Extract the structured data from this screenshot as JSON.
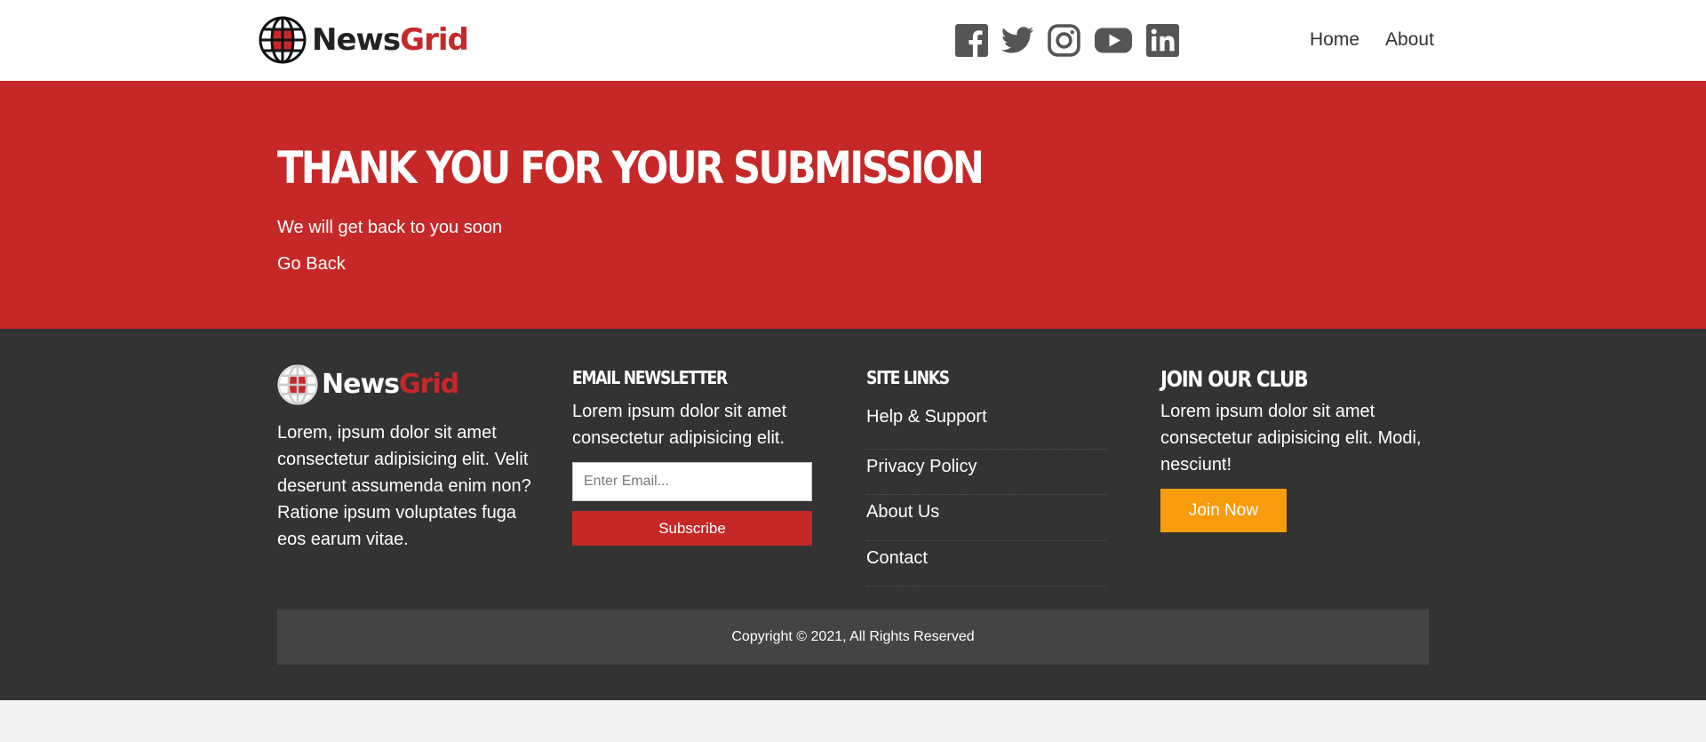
{
  "brand": {
    "name_part1": "News",
    "name_part2": "Grid",
    "accent": "#c62828",
    "logo_icon": "globe-icon"
  },
  "header": {
    "social": [
      {
        "name": "facebook-icon"
      },
      {
        "name": "twitter-icon"
      },
      {
        "name": "instagram-icon"
      },
      {
        "name": "youtube-icon"
      },
      {
        "name": "linkedin-icon"
      }
    ],
    "nav": {
      "home": "Home",
      "about": "About"
    }
  },
  "hero": {
    "title": "Thank You For Your Submission",
    "subtitle": "We will get back to you soon",
    "back_link": "Go Back",
    "background": "#c62828"
  },
  "footer": {
    "about_text": "Lorem, ipsum dolor sit amet consectetur adipisicing elit. Velit deserunt assumenda enim non? Ratione ipsum voluptates fuga eos earum vitae.",
    "newsletter": {
      "heading": "Email Newsletter",
      "text": "Lorem ipsum dolor sit amet consectetur adipisicing elit.",
      "placeholder": "Enter Email...",
      "button": "Subscribe"
    },
    "site_links": {
      "heading": "Site Links",
      "items": [
        "Help & Support",
        "Privacy Policy",
        "About Us",
        "Contact"
      ]
    },
    "club": {
      "heading": "Join Our Club",
      "text": "Lorem ipsum dolor sit amet consectetur adipisicing elit. Modi, nesciunt!",
      "button": "Join Now",
      "button_color": "#f89c0e"
    },
    "copyright": "Copyright © 2021, All Rights Reserved"
  }
}
